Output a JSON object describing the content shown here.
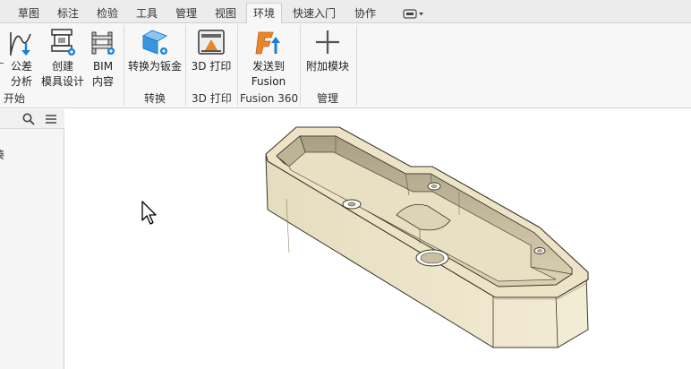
{
  "tabs": [
    {
      "label": "草图",
      "active": false
    },
    {
      "label": "标注",
      "active": false
    },
    {
      "label": "检验",
      "active": false
    },
    {
      "label": "工具",
      "active": false
    },
    {
      "label": "管理",
      "active": false
    },
    {
      "label": "视图",
      "active": false
    },
    {
      "label": "环境",
      "active": true
    },
    {
      "label": "快速入门",
      "active": false
    },
    {
      "label": "协作",
      "active": false
    }
  ],
  "ribbon": {
    "begin": {
      "group_label": "开始",
      "tools": [
        {
          "line1": "公差",
          "line2": "分析",
          "icon": "tolerance-analysis-icon"
        },
        {
          "line1": "创建",
          "line2": "模具设计",
          "icon": "mold-design-icon"
        },
        {
          "line1": "BIM",
          "line2": "内容",
          "icon": "bim-content-icon"
        }
      ]
    },
    "convert": {
      "group_label": "转换",
      "tool": {
        "line1": "转换为钣金",
        "icon": "sheet-metal-icon"
      }
    },
    "print3d": {
      "group_label": "3D 打印",
      "tool": {
        "line1": "3D 打印",
        "icon": "3d-print-icon"
      }
    },
    "fusion": {
      "group_label": "Fusion 360",
      "tool": {
        "line1": "发送到",
        "line2": "Fusion",
        "icon": "fusion-360-icon"
      }
    },
    "manage": {
      "group_label": "管理",
      "tool": {
        "line1": "附加模块",
        "icon": "add-ins-icon"
      }
    }
  },
  "browser": {
    "partial_item": "凑"
  },
  "colors": {
    "accent_blue": "#1b7fd3",
    "fusion_orange": "#e8862a",
    "part_face": "#ece3c7",
    "part_edge": "#3a3528"
  }
}
